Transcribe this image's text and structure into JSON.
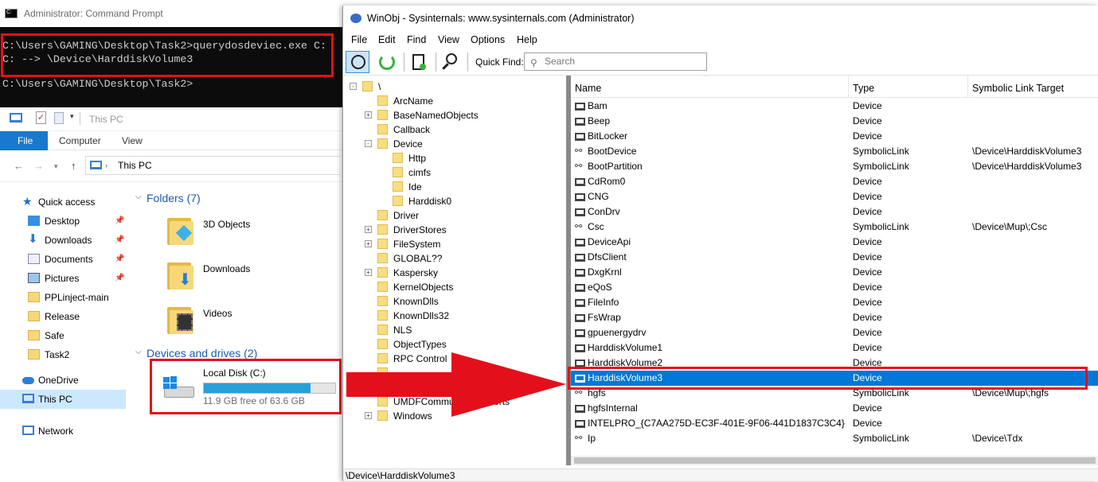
{
  "cmd": {
    "title": "Administrator: Command Prompt",
    "lines": [
      "C:\\Users\\GAMING\\Desktop\\Task2>querydosdeviec.exe C:",
      "C: --> \\Device\\HarddiskVolume3",
      "",
      "C:\\Users\\GAMING\\Desktop\\Task2>"
    ]
  },
  "explorer": {
    "qat_title": "This PC",
    "ribbon_tabs": [
      "File",
      "Computer",
      "View"
    ],
    "address": "This PC",
    "nav": [
      {
        "label": "Quick access",
        "icon": "star-icon",
        "pinned": false
      },
      {
        "label": "Desktop",
        "icon": "desktop-icon",
        "pinned": true
      },
      {
        "label": "Downloads",
        "icon": "download-icon",
        "pinned": true
      },
      {
        "label": "Documents",
        "icon": "documents-icon",
        "pinned": true
      },
      {
        "label": "Pictures",
        "icon": "pictures-icon",
        "pinned": true
      },
      {
        "label": "PPLinject-main",
        "icon": "folder-icon",
        "pinned": false
      },
      {
        "label": "Release",
        "icon": "folder-icon",
        "pinned": false
      },
      {
        "label": "Safe",
        "icon": "folder-icon",
        "pinned": false
      },
      {
        "label": "Task2",
        "icon": "folder-icon",
        "pinned": false
      },
      {
        "label": "OneDrive",
        "icon": "cloud-icon",
        "pinned": false
      },
      {
        "label": "This PC",
        "icon": "computer-icon",
        "pinned": false
      },
      {
        "label": "Network",
        "icon": "network-icon",
        "pinned": false
      }
    ],
    "folders_header": "Folders (7)",
    "folders": [
      "3D Objects",
      "Downloads",
      "Videos"
    ],
    "drives_header": "Devices and drives (2)",
    "drive": {
      "name": "Local Disk (C:)",
      "free": "11.9 GB free of 63.6 GB",
      "used_fraction": 0.81
    }
  },
  "winobj": {
    "title": "WinObj - Sysinternals: www.sysinternals.com (Administrator)",
    "menu": [
      "File",
      "Edit",
      "Find",
      "View",
      "Options",
      "Help"
    ],
    "quick_find_label": "Quick Find:",
    "search_placeholder": "Search",
    "tree": [
      {
        "label": "\\",
        "level": 0,
        "expander": "-"
      },
      {
        "label": "ArcName",
        "level": 1,
        "expander": ""
      },
      {
        "label": "BaseNamedObjects",
        "level": 1,
        "expander": "+"
      },
      {
        "label": "Callback",
        "level": 1,
        "expander": ""
      },
      {
        "label": "Device",
        "level": 1,
        "expander": "-"
      },
      {
        "label": "Http",
        "level": 2,
        "expander": ""
      },
      {
        "label": "cimfs",
        "level": 2,
        "expander": ""
      },
      {
        "label": "Ide",
        "level": 2,
        "expander": ""
      },
      {
        "label": "Harddisk0",
        "level": 2,
        "expander": ""
      },
      {
        "label": "Driver",
        "level": 1,
        "expander": ""
      },
      {
        "label": "DriverStores",
        "level": 1,
        "expander": "+"
      },
      {
        "label": "FileSystem",
        "level": 1,
        "expander": "+"
      },
      {
        "label": "GLOBAL??",
        "level": 1,
        "expander": ""
      },
      {
        "label": "Kaspersky",
        "level": 1,
        "expander": "+"
      },
      {
        "label": "KernelObjects",
        "level": 1,
        "expander": ""
      },
      {
        "label": "KnownDlls",
        "level": 1,
        "expander": ""
      },
      {
        "label": "KnownDlls32",
        "level": 1,
        "expander": ""
      },
      {
        "label": "NLS",
        "level": 1,
        "expander": ""
      },
      {
        "label": "ObjectTypes",
        "level": 1,
        "expander": ""
      },
      {
        "label": "RPC Control",
        "level": 1,
        "expander": ""
      },
      {
        "label": "",
        "level": 1,
        "expander": ""
      },
      {
        "label": "",
        "level": 1,
        "expander": ""
      },
      {
        "label": "UMDFCommunicationPorts",
        "level": 1,
        "expander": ""
      },
      {
        "label": "Windows",
        "level": 1,
        "expander": "+"
      }
    ],
    "columns": [
      "Name",
      "Type",
      "Symbolic Link Target"
    ],
    "rows": [
      {
        "name": "Bam",
        "type": "Device",
        "target": ""
      },
      {
        "name": "Beep",
        "type": "Device",
        "target": ""
      },
      {
        "name": "BitLocker",
        "type": "Device",
        "target": ""
      },
      {
        "name": "BootDevice",
        "type": "SymbolicLink",
        "target": "\\Device\\HarddiskVolume3"
      },
      {
        "name": "BootPartition",
        "type": "SymbolicLink",
        "target": "\\Device\\HarddiskVolume3"
      },
      {
        "name": "CdRom0",
        "type": "Device",
        "target": ""
      },
      {
        "name": "CNG",
        "type": "Device",
        "target": ""
      },
      {
        "name": "ConDrv",
        "type": "Device",
        "target": ""
      },
      {
        "name": "Csc",
        "type": "SymbolicLink",
        "target": "\\Device\\Mup\\;Csc"
      },
      {
        "name": "DeviceApi",
        "type": "Device",
        "target": ""
      },
      {
        "name": "DfsClient",
        "type": "Device",
        "target": ""
      },
      {
        "name": "DxgKrnl",
        "type": "Device",
        "target": ""
      },
      {
        "name": "eQoS",
        "type": "Device",
        "target": ""
      },
      {
        "name": "FileInfo",
        "type": "Device",
        "target": ""
      },
      {
        "name": "FsWrap",
        "type": "Device",
        "target": ""
      },
      {
        "name": "gpuenergydrv",
        "type": "Device",
        "target": ""
      },
      {
        "name": "HarddiskVolume1",
        "type": "Device",
        "target": ""
      },
      {
        "name": "HarddiskVolume2",
        "type": "Device",
        "target": ""
      },
      {
        "name": "HarddiskVolume3",
        "type": "Device",
        "target": "",
        "selected": true
      },
      {
        "name": "hgfs",
        "type": "SymbolicLink",
        "target": "\\Device\\Mup\\;hgfs"
      },
      {
        "name": "hgfsInternal",
        "type": "Device",
        "target": ""
      },
      {
        "name": "INTELPRO_{C7AA275D-EC3F-401E-9F06-441D1837C3C4}",
        "type": "Device",
        "target": ""
      },
      {
        "name": "Ip",
        "type": "SymbolicLink",
        "target": "\\Device\\Tdx"
      }
    ],
    "status": "\\Device\\HarddiskVolume3"
  },
  "colors": {
    "highlight": "#e3101b",
    "selection": "#0078d7",
    "accent": "#1979ca"
  }
}
